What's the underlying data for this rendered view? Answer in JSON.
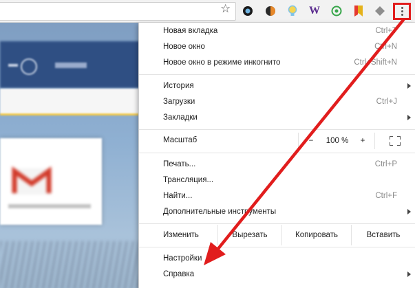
{
  "toolbar": {
    "star_icon": "star-icon",
    "extensions": [
      {
        "name": "ext-dark-circle-icon",
        "color": "#1a1a1a"
      },
      {
        "name": "ext-orange-ring-icon",
        "color": "#e8892a"
      },
      {
        "name": "ext-bulb-icon",
        "color": "#e6c84a"
      },
      {
        "name": "ext-w-icon",
        "color": "#5b2c8f",
        "text": "W"
      },
      {
        "name": "ext-green-ring-icon",
        "color": "#37a64a"
      },
      {
        "name": "ext-bookmark-icon",
        "color": "#e5b21a"
      },
      {
        "name": "ext-diamond-icon",
        "color": "#8d8d8d"
      }
    ],
    "menu_icon": "three-dots-vertical-icon",
    "highlight_color": "#e11d1d"
  },
  "menu": {
    "new_tab": {
      "label": "Новая вкладка",
      "shortcut": "Ctrl+T"
    },
    "new_window": {
      "label": "Новое окно",
      "shortcut": "Ctrl+N"
    },
    "incognito": {
      "label": "Новое окно в режиме инкогнито",
      "shortcut": "Ctrl+Shift+N"
    },
    "history": {
      "label": "История"
    },
    "downloads": {
      "label": "Загрузки",
      "shortcut": "Ctrl+J"
    },
    "bookmarks": {
      "label": "Закладки"
    },
    "zoom": {
      "label": "Масштаб",
      "minus": "−",
      "value": "100 %",
      "plus": "+"
    },
    "print": {
      "label": "Печать...",
      "shortcut": "Ctrl+P"
    },
    "cast": {
      "label": "Трансляция..."
    },
    "find": {
      "label": "Найти...",
      "shortcut": "Ctrl+F"
    },
    "more_tools": {
      "label": "Дополнительные инструменты"
    },
    "edit": {
      "label": "Изменить",
      "cut": "Вырезать",
      "copy": "Копировать",
      "paste": "Вставить"
    },
    "settings": {
      "label": "Настройки"
    },
    "help": {
      "label": "Справка"
    }
  }
}
